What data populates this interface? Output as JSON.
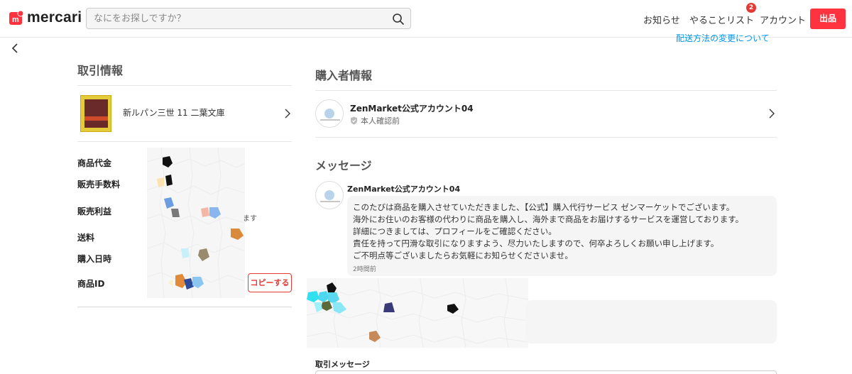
{
  "header": {
    "logo_text": "mercari",
    "search_placeholder": "なにをお探しですか？",
    "nav": {
      "news": "お知らせ",
      "todo": "やることリスト",
      "todo_badge": "2",
      "account": "アカウント",
      "sell": "出品"
    }
  },
  "top_link": "配送方法の変更について",
  "transaction": {
    "title": "取引情報",
    "item_title": "新ルパン三世 11 二葉文庫",
    "labels": {
      "price": "商品代金",
      "fee": "販売手数料",
      "profit": "販売利益",
      "shipping": "送料",
      "purchase_date": "購入日時",
      "item_id": "商品ID"
    },
    "masu": "ます",
    "copy_button": "コピーする"
  },
  "buyer": {
    "title": "購入者情報",
    "name": "ZenMarket公式アカウント04",
    "verification": "本人確認前"
  },
  "messages": {
    "title": "メッセージ",
    "items": [
      {
        "author": "ZenMarket公式アカウント04",
        "lines": [
          "このたびは商品を購入させていただきました、【公式】購入代行サービス ゼンマーケットでございます。",
          "海外にお住いのお客様の代わりに商品を購入し、海外まで商品をお届けするサービスを運営しております。",
          "詳細につきましては、プロフィールをご確認ください。",
          "責任を持って円滑な取引になりますよう、尽力いたしますので、何卒よろしくお願い申し上げます。",
          "ご不明点等ございましたらお気軽にお知らせくださいませ。"
        ],
        "time": "2時間前"
      }
    ],
    "compose_label": "取引メッセージ"
  },
  "colors": {
    "brand_red": "#ff333f",
    "link_blue": "#0095ee",
    "badge_red": "#e53935"
  }
}
